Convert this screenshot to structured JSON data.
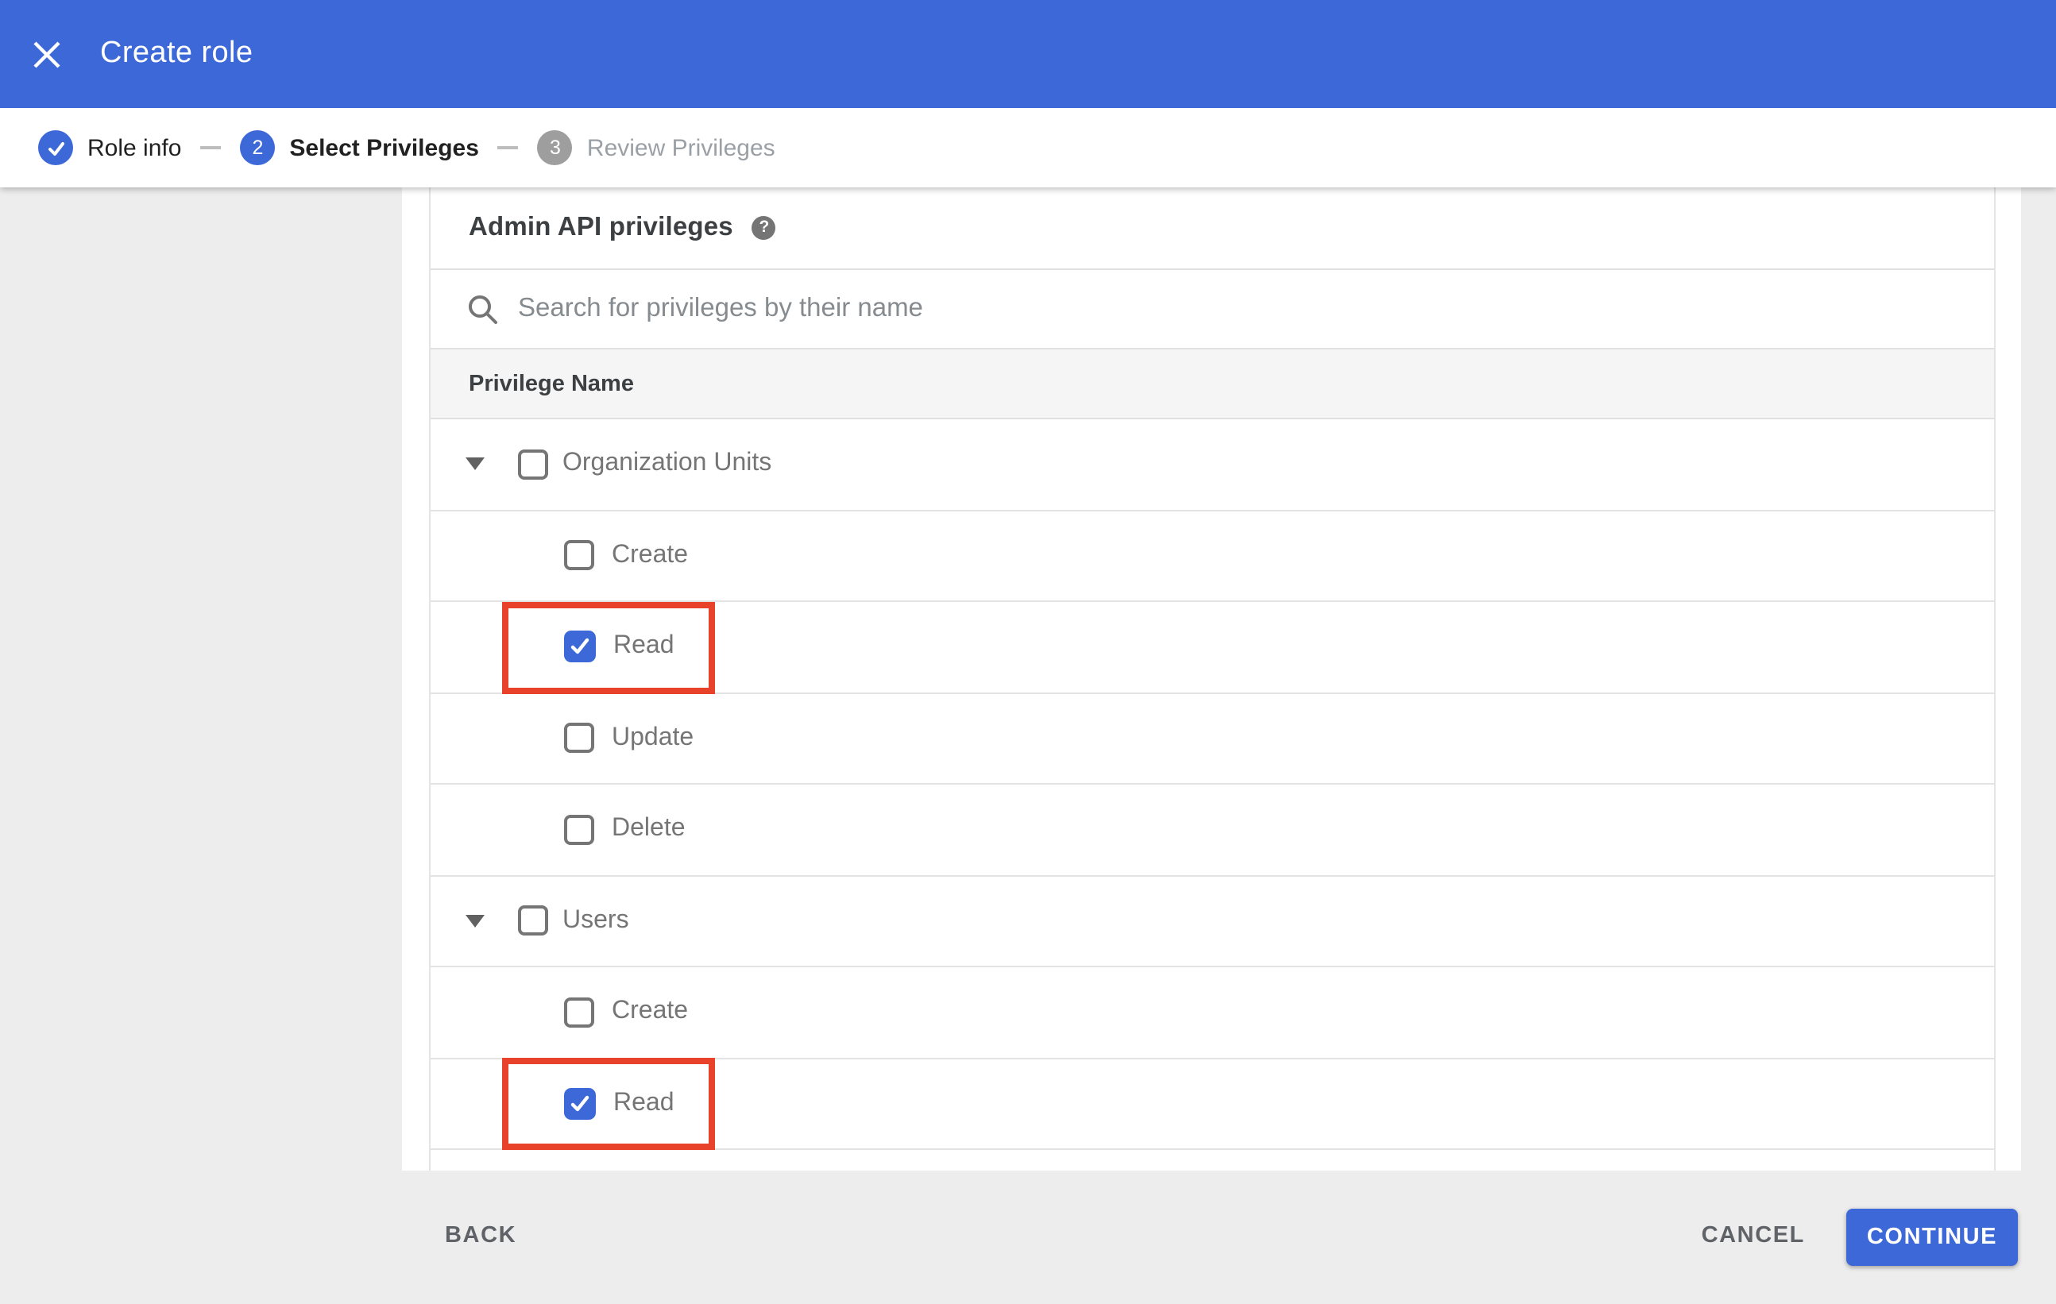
{
  "header": {
    "title": "Create role"
  },
  "stepper": {
    "steps": [
      {
        "number": "1",
        "label": "Role info",
        "state": "completed"
      },
      {
        "number": "2",
        "label": "Select Privileges",
        "state": "active"
      },
      {
        "number": "3",
        "label": "Review Privileges",
        "state": "upcoming"
      }
    ]
  },
  "content": {
    "heading": "Admin API privileges",
    "help_glyph": "?",
    "search_placeholder": "Search for privileges by their name",
    "table_header": "Privilege Name",
    "groups": [
      {
        "label": "Organization Units",
        "checked": false,
        "expanded": true,
        "children": [
          {
            "label": "Create",
            "checked": false,
            "highlighted": false
          },
          {
            "label": "Read",
            "checked": true,
            "highlighted": true
          },
          {
            "label": "Update",
            "checked": false,
            "highlighted": false
          },
          {
            "label": "Delete",
            "checked": false,
            "highlighted": false
          }
        ]
      },
      {
        "label": "Users",
        "checked": false,
        "expanded": true,
        "children": [
          {
            "label": "Create",
            "checked": false,
            "highlighted": false
          },
          {
            "label": "Read",
            "checked": true,
            "highlighted": true
          }
        ]
      }
    ]
  },
  "footer": {
    "back_label": "BACK",
    "cancel_label": "CANCEL",
    "continue_label": "CONTINUE"
  },
  "colors": {
    "accent_blue": "#3d68d8",
    "highlight_red": "#e8422a",
    "background_gray": "#ededed"
  }
}
